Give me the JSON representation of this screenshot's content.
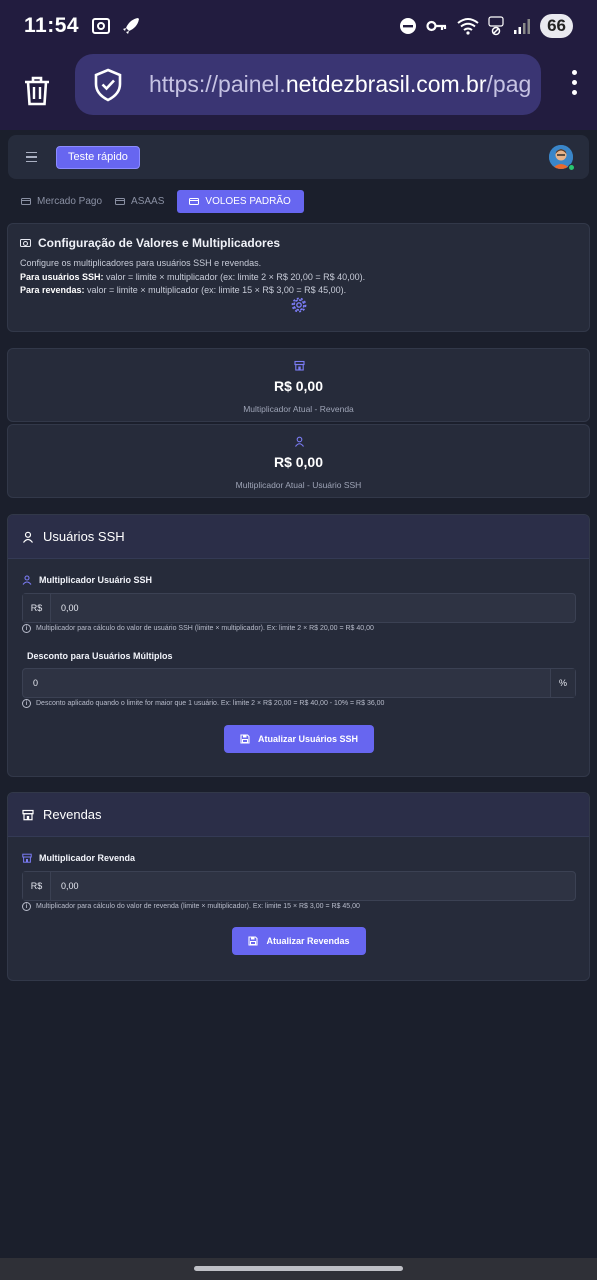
{
  "status_bar": {
    "time": "11:54",
    "battery": "66"
  },
  "browser": {
    "url_prefix": "https://painel.",
    "url_domain": "netdezbrasil.com.br",
    "url_suffix": "/pag"
  },
  "topnav": {
    "quick_test_label": "Teste rápido"
  },
  "tabs": [
    {
      "label": "Mercado Pago"
    },
    {
      "label": "ASAAS"
    },
    {
      "label": "VOLOES PADRÃO"
    }
  ],
  "config": {
    "title": "Configuração de Valores e Multiplicadores",
    "description": "Configure os multiplicadores para usuários SSH e revendas.",
    "ssh_label": "Para usuários SSH:",
    "ssh_text": " valor = limite × multiplicador (ex: limite 2 × R$ 20,00 = R$ 40,00).",
    "rev_label": "Para revendas:",
    "rev_text": " valor = limite × multiplicador (ex: limite 15 × R$ 3,00 = R$ 45,00)."
  },
  "stats": [
    {
      "value": "R$ 0,00",
      "label": "Multiplicador Atual - Revenda"
    },
    {
      "value": "R$ 0,00",
      "label": "Multiplicador Atual - Usuário SSH"
    }
  ],
  "ssh_section": {
    "title": "Usuários SSH",
    "multiplier_label": "Multiplicador Usuário SSH",
    "multiplier_prefix": "R$",
    "multiplier_value": "0,00",
    "multiplier_hint": "Multiplicador para cálculo do valor de usuário SSH (limite × multiplicador). Ex: limite 2 × R$ 20,00 = R$ 40,00",
    "discount_label": "Desconto para Usuários Múltiplos",
    "discount_value": "0",
    "discount_suffix": "%",
    "discount_hint": "Desconto aplicado quando o limite for maior que 1 usuário. Ex: limite 2 × R$ 20,00 = R$ 40,00 - 10% = R$ 36,00",
    "button_label": "Atualizar Usuários SSH"
  },
  "rev_section": {
    "title": "Revendas",
    "multiplier_label": "Multiplicador Revenda",
    "multiplier_prefix": "R$",
    "multiplier_value": "0,00",
    "multiplier_hint": "Multiplicador para cálculo do valor de revenda (limite × multiplicador). Ex: limite 15 × R$ 3,00 = R$ 45,00",
    "button_label": "Atualizar Revendas"
  },
  "colors": {
    "accent": "#6766f0",
    "background": "#1b1f2c",
    "card": "#262b3a",
    "browser_bar": "#221c3f"
  }
}
